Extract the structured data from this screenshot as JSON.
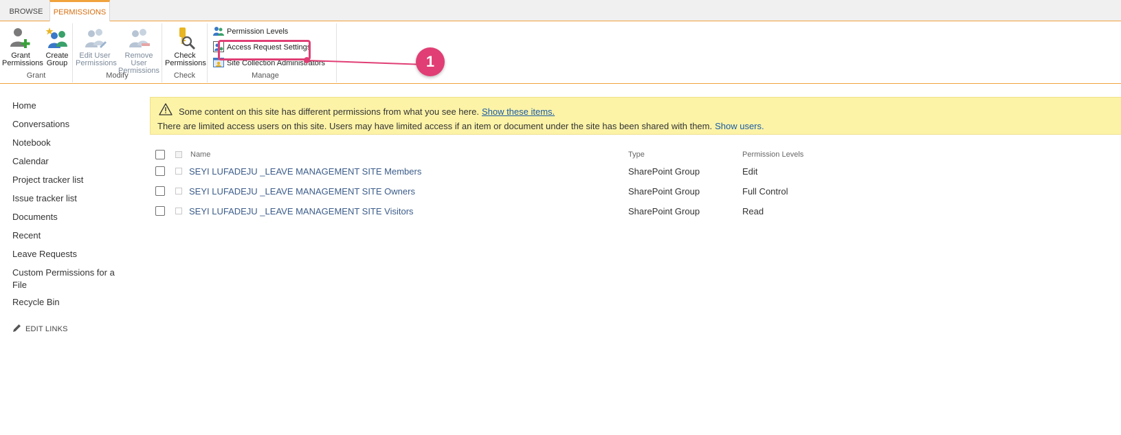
{
  "tabs": {
    "browse": "BROWSE",
    "permissions": "PERMISSIONS"
  },
  "ribbon": {
    "grant": {
      "label": "Grant",
      "grant_permissions": [
        "Grant",
        "Permissions"
      ],
      "create_group": [
        "Create",
        "Group"
      ]
    },
    "modify": {
      "label": "Modify",
      "edit_user_permissions": [
        "Edit User",
        "Permissions"
      ],
      "remove_user_permissions": [
        "Remove User",
        "Permissions"
      ]
    },
    "check": {
      "label": "Check",
      "check_permissions": [
        "Check",
        "Permissions"
      ]
    },
    "manage": {
      "label": "Manage",
      "permission_levels": "Permission Levels",
      "access_request_settings": "Access Request Settings",
      "site_collection_administrators": "Site Collection Administrators"
    }
  },
  "callout": {
    "number": "1",
    "color": "#e03e74"
  },
  "leftnav": {
    "items": [
      "Home",
      "Conversations",
      "Notebook",
      "Calendar",
      "Project tracker list",
      "Issue tracker list",
      "Documents",
      "Recent",
      "Leave Requests",
      "Custom Permissions for a File",
      "Recycle Bin"
    ],
    "edit_links": "EDIT LINKS"
  },
  "banner": {
    "line1_text": "Some content on this site has different permissions from what you see here.",
    "line1_link": "Show these items.",
    "line2_text": "There are limited access users on this site. Users may have limited access if an item or document under the site has been shared with them.",
    "line2_link": "Show users."
  },
  "table": {
    "headers": {
      "name": "Name",
      "type": "Type",
      "permission_levels": "Permission Levels"
    },
    "rows": [
      {
        "name": "SEYI LUFADEJU _LEAVE MANAGEMENT SITE Members",
        "type": "SharePoint Group",
        "permission_levels": "Edit"
      },
      {
        "name": "SEYI LUFADEJU _LEAVE MANAGEMENT SITE Owners",
        "type": "SharePoint Group",
        "permission_levels": "Full Control"
      },
      {
        "name": "SEYI LUFADEJU _LEAVE MANAGEMENT SITE Visitors",
        "type": "SharePoint Group",
        "permission_levels": "Read"
      }
    ]
  },
  "colors": {
    "accent_orange": "#f0a23c",
    "tab_active_text": "#d86d0d",
    "link_blue": "#1a5aa6",
    "banner_bg": "#fcf3a7"
  },
  "icons": [
    "grant-permissions-icon",
    "create-group-icon",
    "edit-user-permissions-icon",
    "remove-user-permissions-icon",
    "check-permissions-icon",
    "permission-levels-icon",
    "access-request-settings-icon",
    "site-collection-administrators-icon",
    "warning-icon",
    "pencil-icon"
  ]
}
